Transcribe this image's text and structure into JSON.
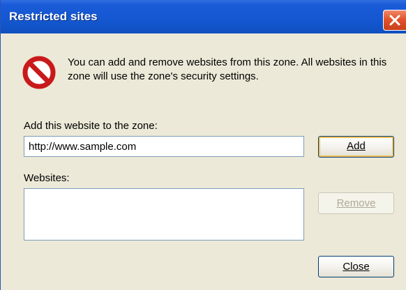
{
  "window": {
    "title": "Restricted sites",
    "close_icon": "close-icon"
  },
  "info": {
    "icon": "prohibited-icon",
    "text": "You can add and remove websites from this zone. All websites in this zone will use the zone's security settings."
  },
  "add_section": {
    "label": "Add this website to the zone:",
    "url_value": "http://www.sample.com",
    "add_button_label": "Add"
  },
  "websites_section": {
    "label": "Websites:",
    "items": [],
    "remove_button_label": "Remove"
  },
  "footer": {
    "close_button_label": "Close"
  },
  "colors": {
    "titlebar": "#1457d0",
    "dialog_bg": "#ece9d8",
    "prohibited_red": "#d42020",
    "close_button_red": "#e2532c"
  }
}
